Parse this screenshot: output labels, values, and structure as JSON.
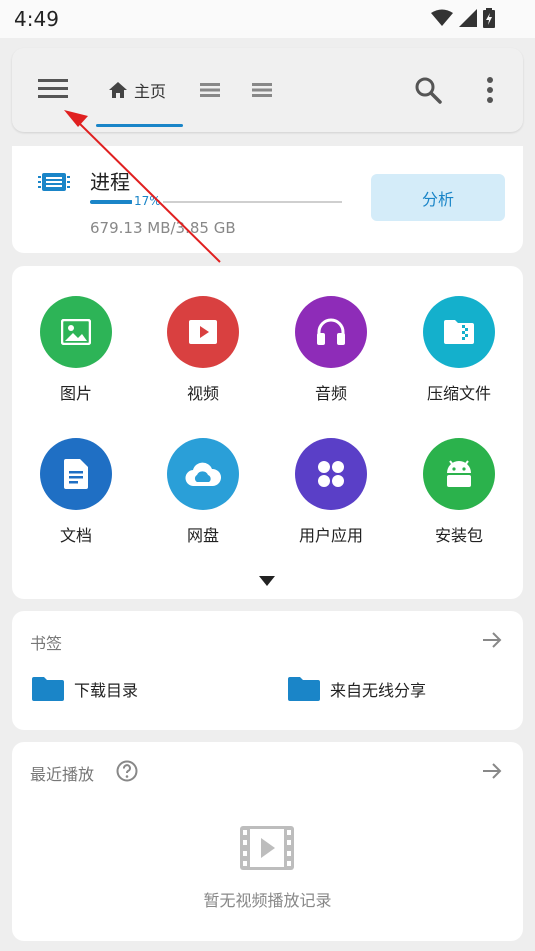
{
  "status": {
    "time": "4:49"
  },
  "tabs": {
    "home_label": "主页"
  },
  "process": {
    "title": "进程",
    "progress_percent": 17,
    "progress_label": "17%",
    "size": "679.13 MB/3.85 GB",
    "analyze_label": "分析"
  },
  "categories": [
    {
      "label": "图片",
      "icon": "image-icon",
      "color": "#2db457"
    },
    {
      "label": "视频",
      "icon": "video-icon",
      "color": "#d94040"
    },
    {
      "label": "音频",
      "icon": "headphones-icon",
      "color": "#8e2cb8"
    },
    {
      "label": "压缩文件",
      "icon": "archive-icon",
      "color": "#14b0cc"
    },
    {
      "label": "文档",
      "icon": "document-icon",
      "color": "#1f6fc4"
    },
    {
      "label": "网盘",
      "icon": "cloud-icon",
      "color": "#2a9fd8"
    },
    {
      "label": "用户应用",
      "icon": "apps-icon",
      "color": "#5a3fc7"
    },
    {
      "label": "安装包",
      "icon": "android-icon",
      "color": "#2bb24c"
    }
  ],
  "bookmarks": {
    "title": "书签",
    "items": [
      {
        "label": "下载目录"
      },
      {
        "label": "来自无线分享"
      }
    ]
  },
  "recent": {
    "title": "最近播放",
    "empty_text": "暂无视频播放记录"
  },
  "colors": {
    "accent": "#1a85c8",
    "annotation": "#e02020"
  }
}
